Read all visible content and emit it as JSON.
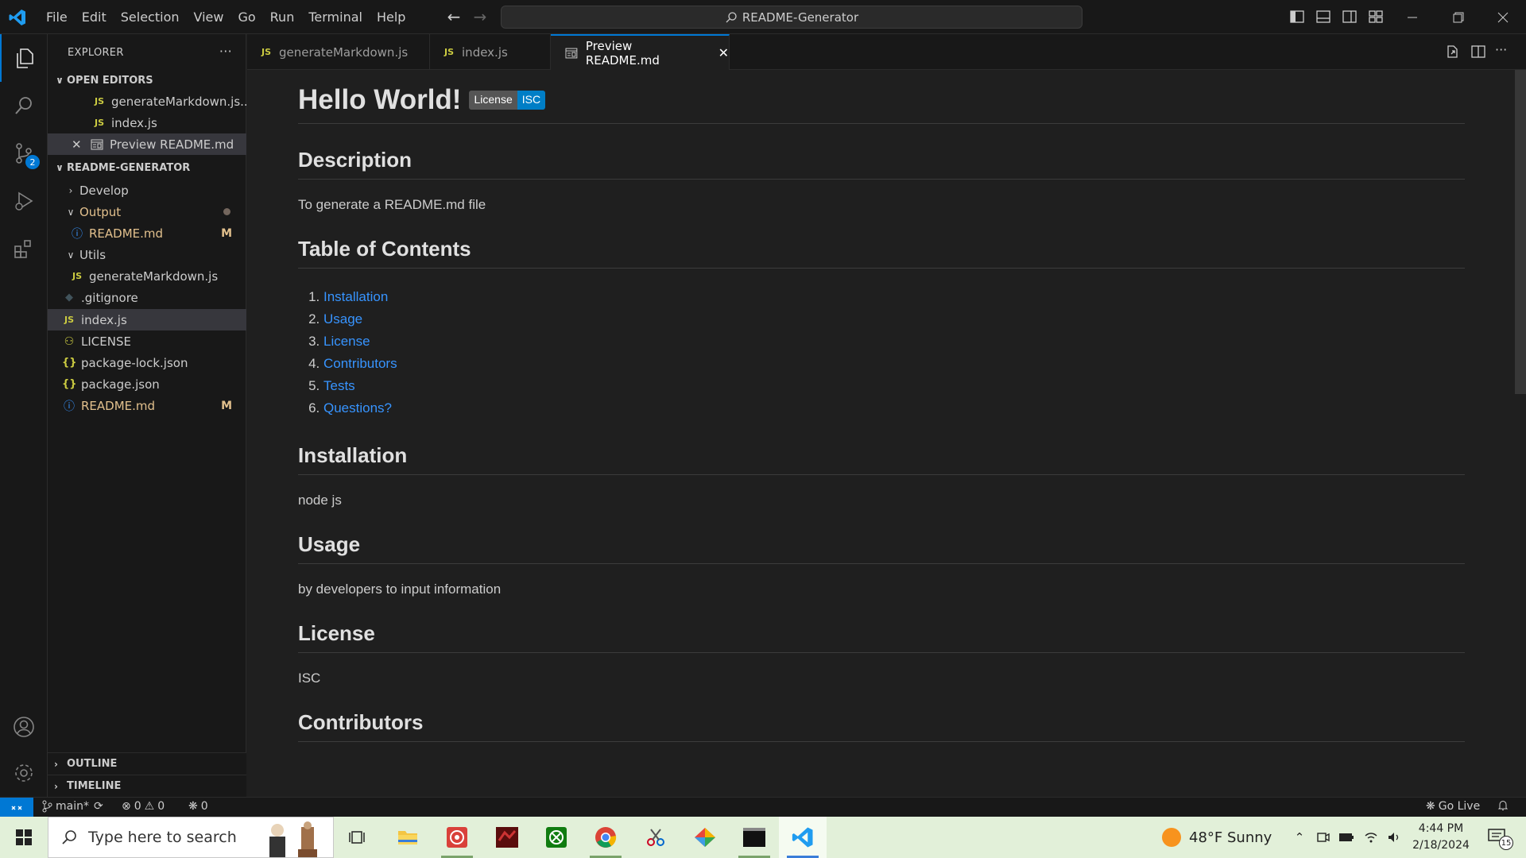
{
  "window": {
    "search_text": "README-Generator",
    "menu": [
      "File",
      "Edit",
      "Selection",
      "View",
      "Go",
      "Run",
      "Terminal",
      "Help"
    ]
  },
  "activity": {
    "scm_badge": "2"
  },
  "explorer": {
    "title": "EXPLORER",
    "open_editors_label": "OPEN EDITORS",
    "open_editors": [
      {
        "name": "generateMarkdown.js...",
        "icon": "JS"
      },
      {
        "name": "index.js",
        "icon": "JS"
      },
      {
        "name": "Preview README.md",
        "icon": "preview"
      }
    ],
    "project_label": "README-GENERATOR",
    "tree": [
      {
        "name": "Develop",
        "type": "folder-collapsed"
      },
      {
        "name": "Output",
        "type": "folder-open"
      },
      {
        "name": "README.md",
        "type": "info",
        "status": "M"
      },
      {
        "name": "Utils",
        "type": "folder-open"
      },
      {
        "name": "generateMarkdown.js",
        "type": "js"
      },
      {
        "name": ".gitignore",
        "type": "git"
      },
      {
        "name": "index.js",
        "type": "js"
      },
      {
        "name": "LICENSE",
        "type": "license"
      },
      {
        "name": "package-lock.json",
        "type": "json"
      },
      {
        "name": "package.json",
        "type": "json"
      },
      {
        "name": "README.md",
        "type": "info",
        "status": "M"
      }
    ],
    "outline_label": "OUTLINE",
    "timeline_label": "TIMELINE"
  },
  "tabs": [
    {
      "label": "generateMarkdown.js",
      "icon": "JS"
    },
    {
      "label": "index.js",
      "icon": "JS"
    },
    {
      "label": "Preview README.md",
      "icon": "preview",
      "active": true
    }
  ],
  "preview": {
    "title": "Hello World!",
    "badge_left": "License",
    "badge_right": "ISC",
    "description_heading": "Description",
    "description_text": "To generate a README.md file",
    "toc_heading": "Table of Contents",
    "toc": [
      "Installation",
      "Usage",
      "License",
      "Contributors",
      "Tests",
      "Questions?"
    ],
    "installation_heading": "Installation",
    "installation_text": "node js",
    "usage_heading": "Usage",
    "usage_text": "by developers to input information",
    "license_heading": "License",
    "license_text": "ISC",
    "contributors_heading": "Contributors"
  },
  "statusbar": {
    "branch": "main*",
    "errors": "0",
    "warnings": "0",
    "ports": "0",
    "go_live": "Go Live"
  },
  "taskbar": {
    "search_placeholder": "Type here to search",
    "weather": "48°F  Sunny",
    "time": "4:44 PM",
    "date": "2/18/2024",
    "notifications": "15"
  },
  "colors": {
    "accent": "#0078d4",
    "link": "#3794ff",
    "modified": "#e2c08d",
    "js_icon": "#cbcb41"
  }
}
